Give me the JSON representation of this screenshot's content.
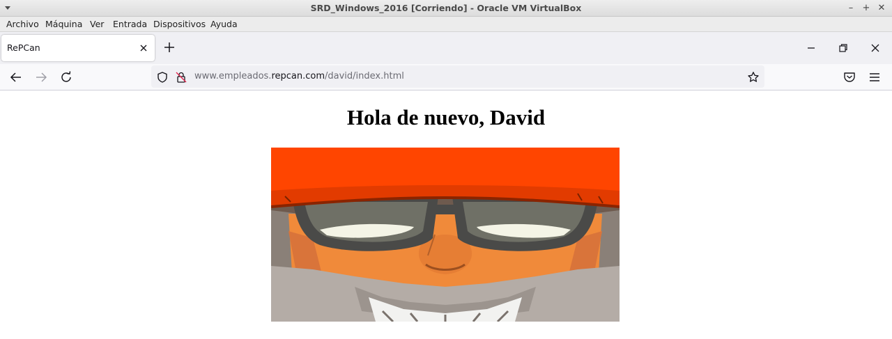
{
  "vm_window": {
    "title": "SRD_Windows_2016 [Corriendo] - Oracle VM VirtualBox",
    "controls": {
      "minimize": "–",
      "maximize": "+",
      "close": "✕"
    }
  },
  "vm_menu": {
    "items": [
      "Archivo",
      "Máquina",
      "Ver",
      "Entrada",
      "Dispositivos",
      "Ayuda"
    ]
  },
  "browser": {
    "tab": {
      "label": "RePCan"
    },
    "url": {
      "prefix": "www.empleados.",
      "host": "repcan.com",
      "path": "/david/index.html"
    }
  },
  "page": {
    "heading": "Hola de nuevo, David",
    "image_subject": "cartoon character face with orange cap and sunglasses"
  },
  "colors": {
    "cap": "#ff4500",
    "skin": "#f08a3a",
    "beard": "#b4aca6",
    "glasses": "#4a4a48"
  }
}
